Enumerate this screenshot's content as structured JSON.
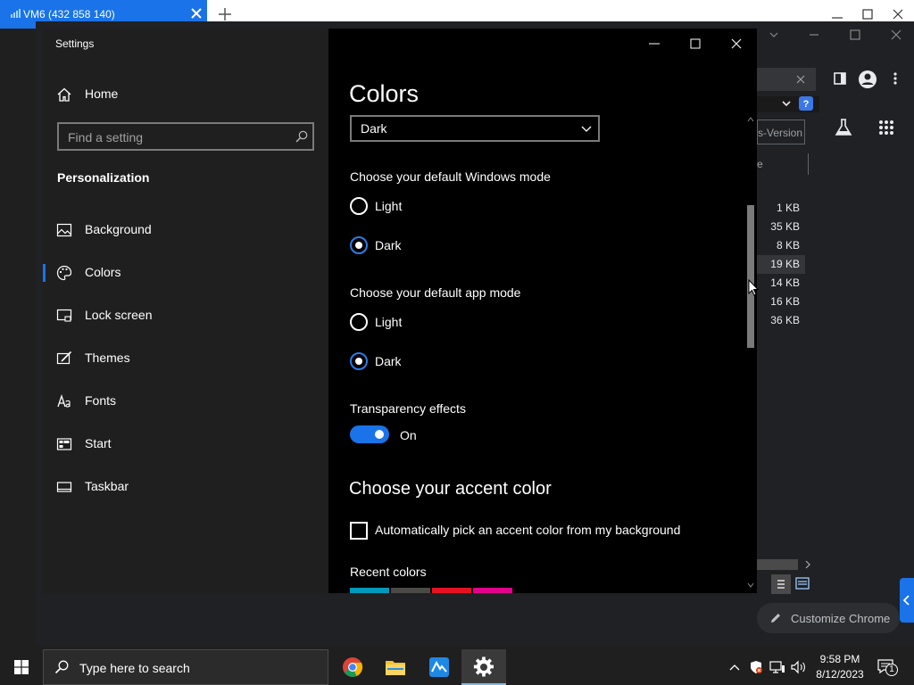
{
  "host": {
    "tab_title": "VM6 (432 858 140)"
  },
  "chrome": {
    "omnibox_text": "s-Version",
    "column_fragment": "e",
    "file_sizes": [
      "1 KB",
      "35 KB",
      "8 KB",
      "19 KB",
      "14 KB",
      "16 KB",
      "36 KB"
    ],
    "customize_label": "Customize Chrome"
  },
  "settings": {
    "window_title": "Settings",
    "sidebar": {
      "home_label": "Home",
      "search_placeholder": "Find a setting",
      "section_title": "Personalization",
      "items": [
        {
          "label": "Background",
          "icon": "picture-icon"
        },
        {
          "label": "Colors",
          "icon": "palette-icon",
          "selected": true
        },
        {
          "label": "Lock screen",
          "icon": "lock-screen-icon"
        },
        {
          "label": "Themes",
          "icon": "brush-icon"
        },
        {
          "label": "Fonts",
          "icon": "font-icon"
        },
        {
          "label": "Start",
          "icon": "start-icon"
        },
        {
          "label": "Taskbar",
          "icon": "taskbar-icon"
        }
      ]
    },
    "main": {
      "page_title": "Colors",
      "color_select_value": "Dark",
      "windows_mode_label": "Choose your default Windows mode",
      "app_mode_label": "Choose your default app mode",
      "opt_light": "Light",
      "opt_dark": "Dark",
      "transparency_label": "Transparency effects",
      "transparency_state": "On",
      "accent_heading": "Choose your accent color",
      "auto_accent_label": "Automatically pick an accent color from my background",
      "recent_colors_label": "Recent colors",
      "recent_colors": [
        "#0099bc",
        "#4c4a48",
        "#e81123",
        "#e3008c"
      ]
    }
  },
  "taskbar": {
    "search_placeholder": "Type here to search",
    "time": "9:58 PM",
    "date": "8/12/2023",
    "notification_count": "1"
  },
  "colors": {
    "accent": "#1a73e8",
    "settings_sidebar": "#1f1f1f",
    "settings_main": "#000000",
    "taskbar": "#1f1f1f"
  }
}
